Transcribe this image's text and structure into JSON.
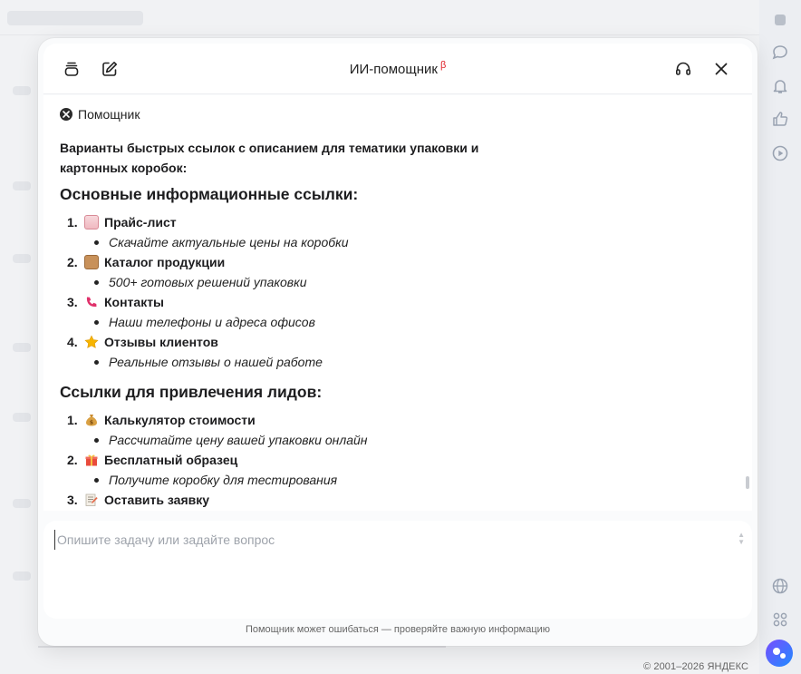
{
  "panel": {
    "title": "ИИ-помощник",
    "beta": "β"
  },
  "chat": {
    "sender": "Помощник",
    "intro": "Варианты быстрых ссылок с описанием для тематики упаковки и картонных коробок:",
    "section1": {
      "heading": "Основные информационные ссылки:",
      "items": [
        {
          "num": "1.",
          "emoji": "clipboard-icon",
          "title": "Прайс-лист",
          "desc": "Скачайте актуальные цены на коробки"
        },
        {
          "num": "2.",
          "emoji": "package-icon",
          "title": "Каталог продукции",
          "desc": "500+ готовых решений упаковки"
        },
        {
          "num": "3.",
          "emoji": "phone-icon",
          "title": "Контакты",
          "desc": "Наши телефоны и адреса офисов"
        },
        {
          "num": "4.",
          "emoji": "star-icon",
          "title": "Отзывы клиентов",
          "desc": "Реальные отзывы о нашей работе"
        }
      ]
    },
    "section2": {
      "heading": "Ссылки для привлечения лидов:",
      "items": [
        {
          "num": "1.",
          "emoji": "money-bag-icon",
          "title": "Калькулятор стоимости",
          "desc": "Рассчитайте цену вашей упаковки онлайн"
        },
        {
          "num": "2.",
          "emoji": "gift-icon",
          "title": "Бесплатный образец",
          "desc": "Получите коробку для тестирования"
        },
        {
          "num": "3.",
          "emoji": "memo-icon",
          "title": "Оставить заявку",
          "desc": ""
        }
      ]
    }
  },
  "input": {
    "placeholder": "Опишите задачу или задайте вопрос"
  },
  "disclaimer": "Помощник может ошибаться — проверяйте важную информацию",
  "copyright": "© 2001–2026 ЯНДЕКС",
  "colors": {
    "beta": "#e0242b",
    "rail_icon": "#9aa3b2"
  }
}
